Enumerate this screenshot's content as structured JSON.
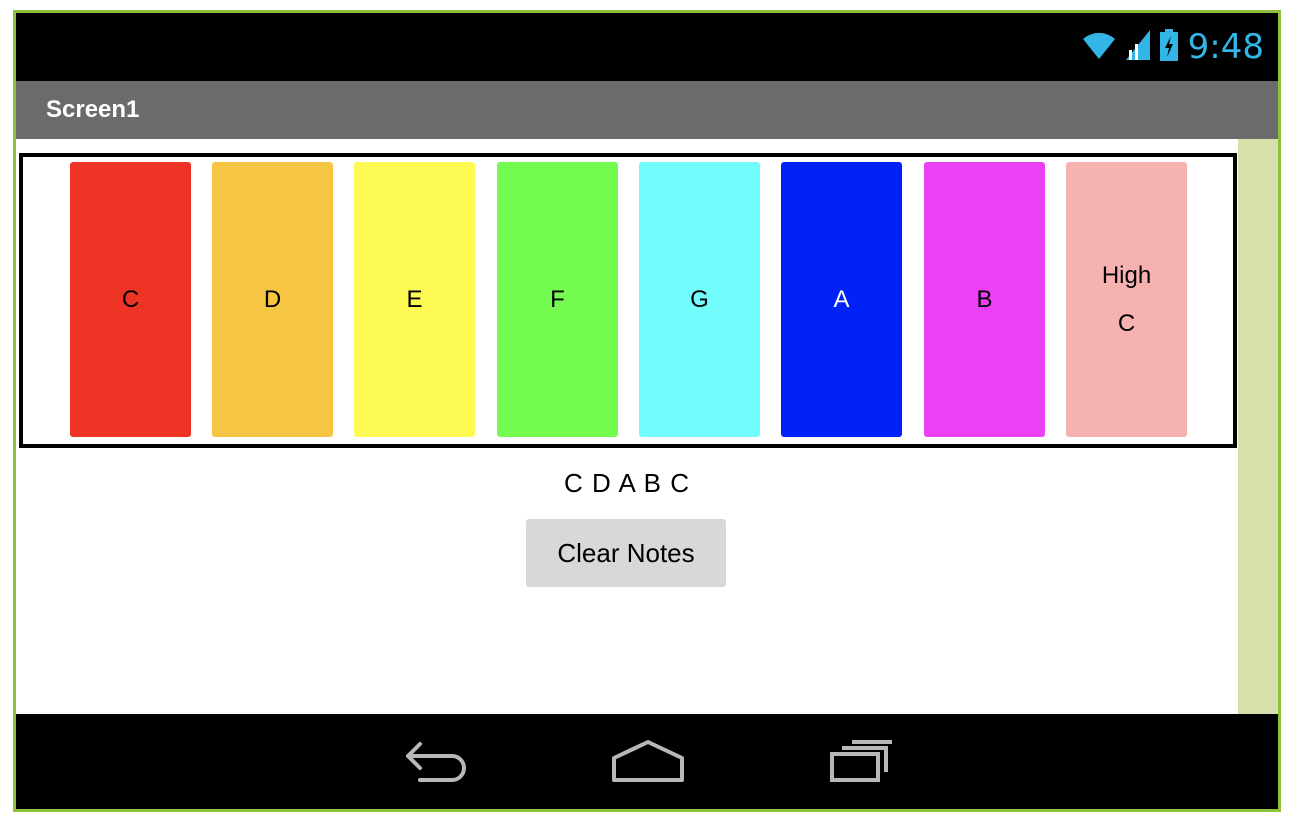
{
  "status_bar": {
    "time": "9:48",
    "icons": [
      "wifi-icon",
      "signal-icon",
      "battery-charging-icon"
    ],
    "icon_color": "#33b5e5"
  },
  "title_bar": {
    "title": "Screen1",
    "background": "#6b6b6b"
  },
  "keys": [
    {
      "line1": "C",
      "line2": "",
      "color": "#ee3424",
      "text_color": "#000000"
    },
    {
      "line1": "D",
      "line2": "",
      "color": "#f7c544",
      "text_color": "#000000"
    },
    {
      "line1": "E",
      "line2": "",
      "color": "#fdfa54",
      "text_color": "#000000"
    },
    {
      "line1": "F",
      "line2": "",
      "color": "#74fb4f",
      "text_color": "#000000"
    },
    {
      "line1": "G",
      "line2": "",
      "color": "#72fcfb",
      "text_color": "#000000"
    },
    {
      "line1": "A",
      "line2": "",
      "color": "#0022f6",
      "text_color": "#ffffff"
    },
    {
      "line1": "B",
      "line2": "",
      "color": "#ec40f5",
      "text_color": "#000000"
    },
    {
      "line1": "High",
      "line2": "C",
      "color": "#f5b2b0",
      "text_color": "#000000"
    }
  ],
  "notes_played": "C D A B C",
  "clear_button": {
    "label": "Clear Notes"
  },
  "nav_bar": {
    "icons": [
      "back-icon",
      "home-icon",
      "recent-apps-icon"
    ]
  },
  "colors": {
    "device_border": "#8fc03c",
    "scroll_strip": "#d5e0ab"
  }
}
